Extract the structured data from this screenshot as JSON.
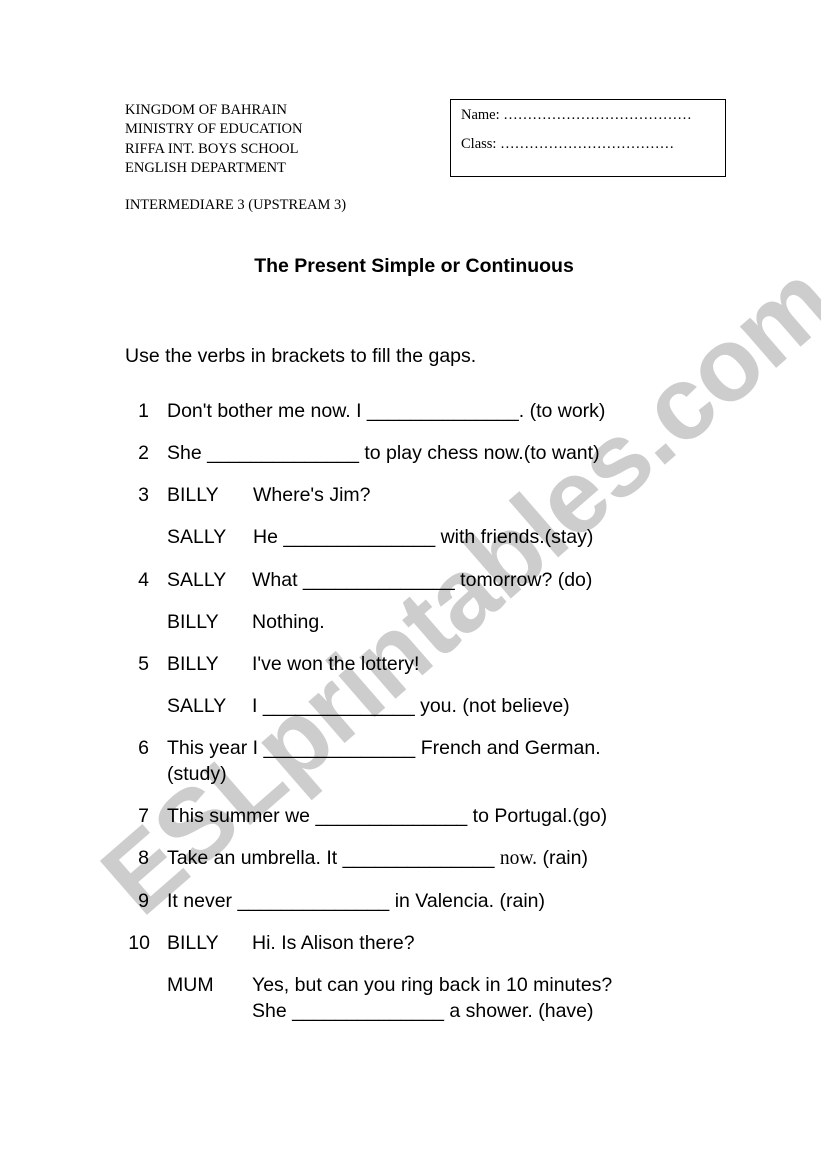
{
  "header": {
    "school_lines": [
      "KINGDOM OF BAHRAIN",
      "MINISTRY OF EDUCATION",
      "RIFFA INT. BOYS SCHOOL",
      "ENGLISH DEPARTMENT"
    ],
    "level": "INTERMEDIARE 3 (UPSTREAM 3)",
    "name_box": {
      "name_label": "Name: …………………………………",
      "class_label": "Class: ………………………………"
    }
  },
  "title": "The Present Simple or Continuous",
  "instructions": "Use the verbs in brackets to fill the gaps.",
  "watermark": "ESLprintables.com",
  "questions": [
    {
      "num": "1",
      "text": "Don't bother me now. I ______________. (to work)"
    },
    {
      "num": "2",
      "text": "She ______________ to play chess now.(to want)"
    },
    {
      "num": "3",
      "speaker": "BILLY",
      "line": " Where's Jim?"
    },
    {
      "speaker": "SALLY",
      "line": "He ______________ with friends.(stay)"
    },
    {
      "num": "4",
      "speaker": "SALLY",
      "line": "What ______________ tomorrow? (do)"
    },
    {
      "speaker": "BILLY",
      "line": "Nothing."
    },
    {
      "num": "5",
      "speaker": "BILLY",
      "line": "I've won the lottery!"
    },
    {
      "speaker": "SALLY",
      "line": "I ______________ you. (not believe)"
    },
    {
      "num": "6",
      "text": "This year I ______________ French and German.",
      "text2": "(study)"
    },
    {
      "num": "7",
      "text": "This summer we ______________ to Portugal.(go)"
    },
    {
      "num": "8",
      "text_a": "Take an umbrella. It ______________ ",
      "text_b": "now.",
      "text_c": " (rain)"
    },
    {
      "num": "9",
      "text": "It never ______________ in Valencia. (rain)"
    },
    {
      "num": "10",
      "speaker": "BILLY",
      "line": "Hi. Is Alison there?"
    },
    {
      "speaker": "MUM",
      "line": "Yes, but can you ring back in 10 minutes?",
      "line2": "She ______________ a shower. (have)"
    }
  ]
}
